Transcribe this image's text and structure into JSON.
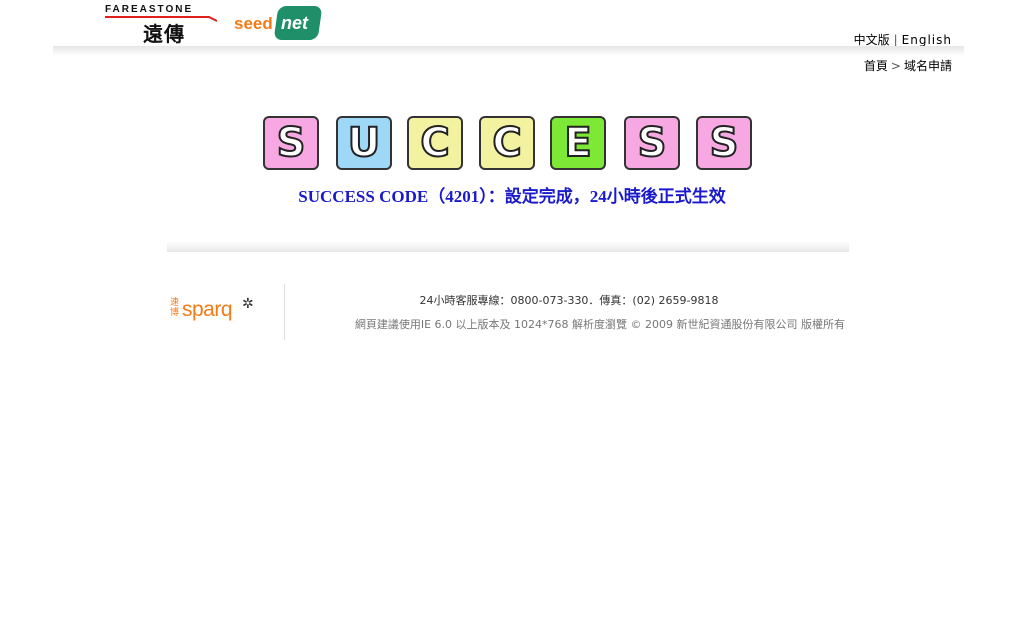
{
  "header": {
    "fet_logo_text": "FAREASTONE",
    "fet_logo_chinese": "遠傳",
    "seednet_logo_seed": "seed",
    "seednet_logo_net": "net",
    "lang_chinese": "中文版",
    "lang_separator": "|",
    "lang_english": "English"
  },
  "breadcrumb": {
    "home": "首頁",
    "arrow": ">",
    "current": "域名申請"
  },
  "success": {
    "letters": [
      {
        "char": "S",
        "color": "#f7a8e2"
      },
      {
        "char": "U",
        "color": "#9fd8f7"
      },
      {
        "char": "C",
        "color": "#f2f2a0"
      },
      {
        "char": "C",
        "color": "#f2f2a0"
      },
      {
        "char": "E",
        "color": "#7ee836"
      },
      {
        "char": "S",
        "color": "#f7a8e2"
      },
      {
        "char": "S",
        "color": "#f7a8e2"
      }
    ],
    "message": "SUCCESS CODE（4201）：設定完成，24小時後正式生效"
  },
  "footer": {
    "sparq_chinese": "速博",
    "sparq_word": "sparq",
    "sparq_star": "✲",
    "contact": "24小時客服專線：0800-073-330．傳真：(02) 2659-9818",
    "copyright": "網頁建議使用IE 6.0 以上版本及 1024*768 解析度瀏覽 ©  2009  新世紀資通股份有限公司 版權所有"
  }
}
